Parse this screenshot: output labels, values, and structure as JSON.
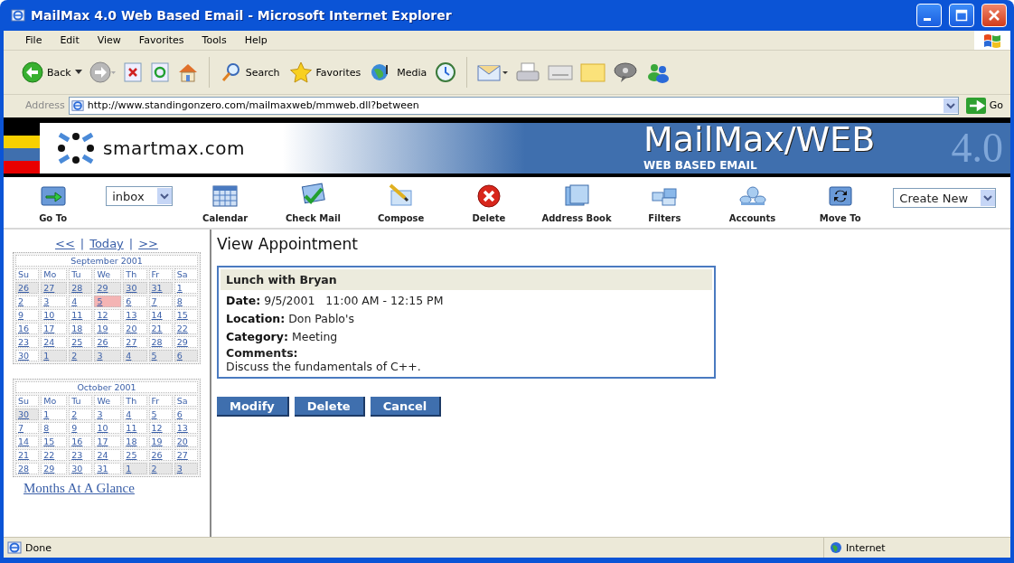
{
  "window": {
    "title": "MailMax 4.0 Web Based Email - Microsoft Internet Explorer"
  },
  "menu": [
    "File",
    "Edit",
    "View",
    "Favorites",
    "Tools",
    "Help"
  ],
  "browser_toolbar": {
    "back": "Back",
    "search": "Search",
    "favorites": "Favorites",
    "media": "Media"
  },
  "address_bar": {
    "label": "Address",
    "url": "http://www.standingonzero.com/mailmaxweb/mmweb.dll?between",
    "go": "Go"
  },
  "banner": {
    "site": "smartmax.com",
    "product": "MailMax/WEB",
    "tagline": "WEB BASED EMAIL",
    "version_mark": "4.0"
  },
  "nav": [
    {
      "kind": "button",
      "label": "Go To"
    },
    {
      "kind": "select",
      "value": "inbox"
    },
    {
      "kind": "button",
      "label": "Calendar"
    },
    {
      "kind": "button",
      "label": "Check Mail"
    },
    {
      "kind": "button",
      "label": "Compose"
    },
    {
      "kind": "button",
      "label": "Delete"
    },
    {
      "kind": "button",
      "label": "Address Book"
    },
    {
      "kind": "button",
      "label": "Filters"
    },
    {
      "kind": "button",
      "label": "Accounts"
    },
    {
      "kind": "button",
      "label": "Move To"
    },
    {
      "kind": "select",
      "value": "Create New"
    }
  ],
  "calendar_nav": {
    "prev": "<<",
    "today": "Today",
    "next": ">>",
    "separators": [
      "|",
      "|"
    ]
  },
  "months": [
    {
      "title": "September 2001",
      "weekdays": [
        "Su",
        "Mo",
        "Tu",
        "We",
        "Th",
        "Fr",
        "Sa"
      ],
      "weeks": [
        [
          {
            "day": "26",
            "outside": true,
            "selected": false
          },
          {
            "day": "27",
            "outside": true,
            "selected": false
          },
          {
            "day": "28",
            "outside": true,
            "selected": false
          },
          {
            "day": "29",
            "outside": true,
            "selected": false
          },
          {
            "day": "30",
            "outside": true,
            "selected": false
          },
          {
            "day": "31",
            "outside": true,
            "selected": false
          },
          {
            "day": "1",
            "outside": false,
            "selected": false
          }
        ],
        [
          {
            "day": "2",
            "outside": false,
            "selected": false
          },
          {
            "day": "3",
            "outside": false,
            "selected": false
          },
          {
            "day": "4",
            "outside": false,
            "selected": false
          },
          {
            "day": "5",
            "outside": false,
            "selected": true
          },
          {
            "day": "6",
            "outside": false,
            "selected": false
          },
          {
            "day": "7",
            "outside": false,
            "selected": false
          },
          {
            "day": "8",
            "outside": false,
            "selected": false
          }
        ],
        [
          {
            "day": "9",
            "outside": false,
            "selected": false
          },
          {
            "day": "10",
            "outside": false,
            "selected": false
          },
          {
            "day": "11",
            "outside": false,
            "selected": false
          },
          {
            "day": "12",
            "outside": false,
            "selected": false
          },
          {
            "day": "13",
            "outside": false,
            "selected": false
          },
          {
            "day": "14",
            "outside": false,
            "selected": false
          },
          {
            "day": "15",
            "outside": false,
            "selected": false
          }
        ],
        [
          {
            "day": "16",
            "outside": false,
            "selected": false
          },
          {
            "day": "17",
            "outside": false,
            "selected": false
          },
          {
            "day": "18",
            "outside": false,
            "selected": false
          },
          {
            "day": "19",
            "outside": false,
            "selected": false
          },
          {
            "day": "20",
            "outside": false,
            "selected": false
          },
          {
            "day": "21",
            "outside": false,
            "selected": false
          },
          {
            "day": "22",
            "outside": false,
            "selected": false
          }
        ],
        [
          {
            "day": "23",
            "outside": false,
            "selected": false
          },
          {
            "day": "24",
            "outside": false,
            "selected": false
          },
          {
            "day": "25",
            "outside": false,
            "selected": false
          },
          {
            "day": "26",
            "outside": false,
            "selected": false
          },
          {
            "day": "27",
            "outside": false,
            "selected": false
          },
          {
            "day": "28",
            "outside": false,
            "selected": false
          },
          {
            "day": "29",
            "outside": false,
            "selected": false
          }
        ],
        [
          {
            "day": "30",
            "outside": false,
            "selected": false
          },
          {
            "day": "1",
            "outside": true,
            "selected": false
          },
          {
            "day": "2",
            "outside": true,
            "selected": false
          },
          {
            "day": "3",
            "outside": true,
            "selected": false
          },
          {
            "day": "4",
            "outside": true,
            "selected": false
          },
          {
            "day": "5",
            "outside": true,
            "selected": false
          },
          {
            "day": "6",
            "outside": true,
            "selected": false
          }
        ]
      ]
    },
    {
      "title": "October 2001",
      "weekdays": [
        "Su",
        "Mo",
        "Tu",
        "We",
        "Th",
        "Fr",
        "Sa"
      ],
      "weeks": [
        [
          {
            "day": "30",
            "outside": true,
            "selected": false
          },
          {
            "day": "1",
            "outside": false,
            "selected": false
          },
          {
            "day": "2",
            "outside": false,
            "selected": false
          },
          {
            "day": "3",
            "outside": false,
            "selected": false
          },
          {
            "day": "4",
            "outside": false,
            "selected": false
          },
          {
            "day": "5",
            "outside": false,
            "selected": false
          },
          {
            "day": "6",
            "outside": false,
            "selected": false
          }
        ],
        [
          {
            "day": "7",
            "outside": false,
            "selected": false
          },
          {
            "day": "8",
            "outside": false,
            "selected": false
          },
          {
            "day": "9",
            "outside": false,
            "selected": false
          },
          {
            "day": "10",
            "outside": false,
            "selected": false
          },
          {
            "day": "11",
            "outside": false,
            "selected": false
          },
          {
            "day": "12",
            "outside": false,
            "selected": false
          },
          {
            "day": "13",
            "outside": false,
            "selected": false
          }
        ],
        [
          {
            "day": "14",
            "outside": false,
            "selected": false
          },
          {
            "day": "15",
            "outside": false,
            "selected": false
          },
          {
            "day": "16",
            "outside": false,
            "selected": false
          },
          {
            "day": "17",
            "outside": false,
            "selected": false
          },
          {
            "day": "18",
            "outside": false,
            "selected": false
          },
          {
            "day": "19",
            "outside": false,
            "selected": false
          },
          {
            "day": "20",
            "outside": false,
            "selected": false
          }
        ],
        [
          {
            "day": "21",
            "outside": false,
            "selected": false
          },
          {
            "day": "22",
            "outside": false,
            "selected": false
          },
          {
            "day": "23",
            "outside": false,
            "selected": false
          },
          {
            "day": "24",
            "outside": false,
            "selected": false
          },
          {
            "day": "25",
            "outside": false,
            "selected": false
          },
          {
            "day": "26",
            "outside": false,
            "selected": false
          },
          {
            "day": "27",
            "outside": false,
            "selected": false
          }
        ],
        [
          {
            "day": "28",
            "outside": false,
            "selected": false
          },
          {
            "day": "29",
            "outside": false,
            "selected": false
          },
          {
            "day": "30",
            "outside": false,
            "selected": false
          },
          {
            "day": "31",
            "outside": false,
            "selected": false
          },
          {
            "day": "1",
            "outside": true,
            "selected": false
          },
          {
            "day": "2",
            "outside": true,
            "selected": false
          },
          {
            "day": "3",
            "outside": true,
            "selected": false
          }
        ]
      ]
    }
  ],
  "months_link": "Months At A Glance",
  "page_title": "View Appointment",
  "appointment": {
    "title": "Lunch with Bryan",
    "fields": [
      {
        "label": "Date:",
        "value": "9/5/2001   11:00 AM - 12:15 PM"
      },
      {
        "label": "Location:",
        "value": "Don Pablo's"
      },
      {
        "label": "Category:",
        "value": "Meeting"
      }
    ],
    "comments_label": "Comments:",
    "comments": "Discuss the fundamentals of C++."
  },
  "buttons": [
    "Modify",
    "Delete",
    "Cancel"
  ],
  "status_bar": {
    "text": "Done",
    "zone": "Internet"
  }
}
